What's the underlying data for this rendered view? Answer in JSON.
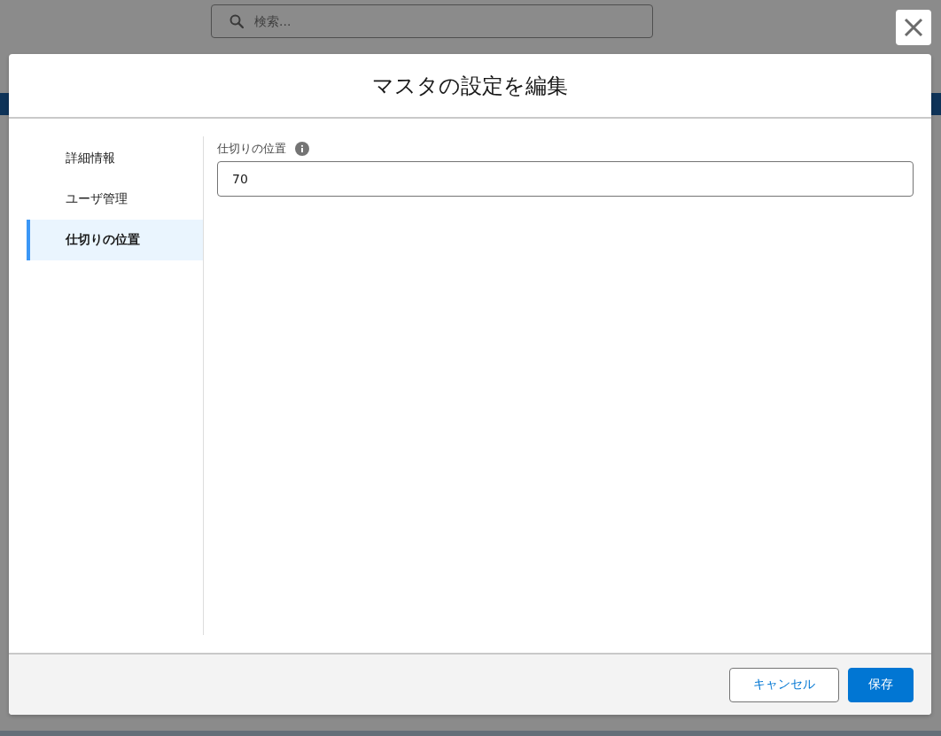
{
  "search": {
    "placeholder": "検索..."
  },
  "modal": {
    "title": "マスタの設定を編集",
    "nav": [
      {
        "label": "詳細情報",
        "selected": false
      },
      {
        "label": "ユーザ管理",
        "selected": false
      },
      {
        "label": "仕切りの位置",
        "selected": true
      }
    ],
    "field": {
      "label": "仕切りの位置",
      "value": "70"
    },
    "buttons": [
      {
        "label": "キャンセル",
        "kind": "neutral"
      },
      {
        "label": "保存",
        "kind": "brand"
      }
    ]
  }
}
